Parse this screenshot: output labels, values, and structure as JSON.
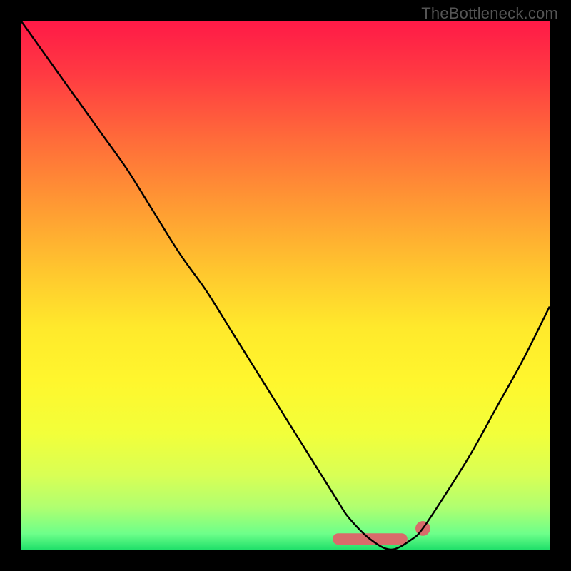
{
  "attribution": "TheBottleneck.com",
  "chart_data": {
    "type": "line",
    "title": "",
    "xlabel": "",
    "ylabel": "",
    "xlim": [
      0,
      100
    ],
    "ylim": [
      0,
      100
    ],
    "series": [
      {
        "name": "curve",
        "x": [
          0,
          5,
          10,
          15,
          20,
          25,
          30,
          35,
          40,
          45,
          50,
          55,
          60,
          62,
          66,
          70,
          74,
          76,
          80,
          85,
          90,
          95,
          100
        ],
        "y": [
          100,
          93,
          86,
          79,
          72,
          64,
          56,
          49,
          41,
          33,
          25,
          17,
          9,
          6,
          2,
          0,
          2,
          4,
          10,
          18,
          27,
          36,
          46
        ]
      }
    ],
    "annotation": {
      "segment_x": [
        60,
        72
      ],
      "segment_y": 2,
      "dot": {
        "x": 76,
        "y": 4
      }
    },
    "colors": {
      "curve": "#000000",
      "annotation": "#d86b6b",
      "gradient_top": "#ff1a47",
      "gradient_bottom": "#20e06a"
    }
  }
}
